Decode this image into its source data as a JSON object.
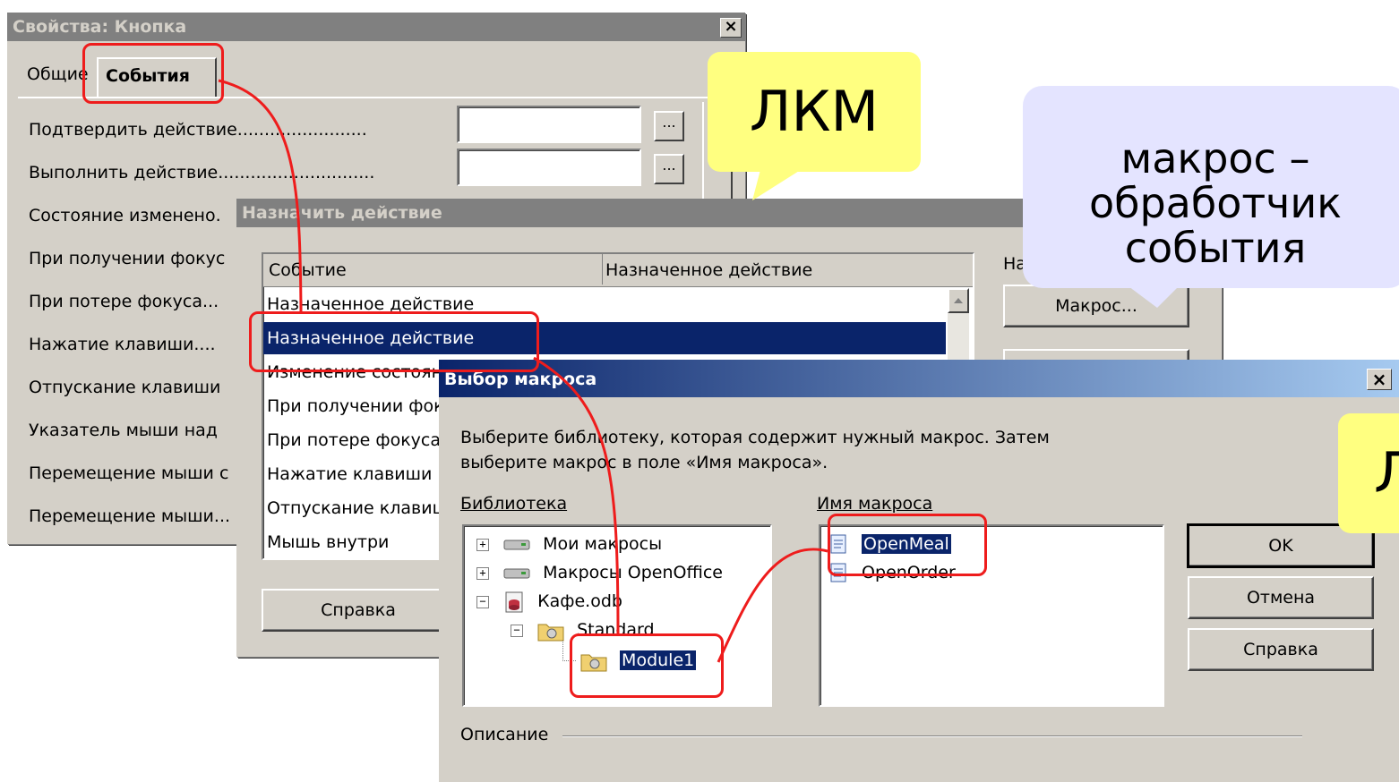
{
  "props_dialog": {
    "title": "Свойства: Кнопка",
    "close": "×",
    "tabs": [
      "Общие",
      "События"
    ],
    "events": [
      "Подтвердить действие........................",
      "Выполнить действие.............................",
      "Состояние изменено.",
      "При получении фокус",
      "При потере фокуса...",
      "Нажатие клавиши....",
      "Отпускание клавиши",
      "Указатель мыши над",
      "Перемещение мыши с",
      "Перемещение мыши..."
    ],
    "dots_button": "..."
  },
  "assign_dialog": {
    "title": "Назначить действие",
    "columns": [
      "Событие",
      "Назначенное действие"
    ],
    "rows": [
      "Назначенное действие",
      "Назначенное действие",
      "Изменение состояния",
      "При получении фокуса",
      "При потере фокуса",
      "Нажатие клавиши",
      "Отпускание клавиши",
      "Мышь внутри"
    ],
    "right_label": "На",
    "macro_button": "Макрос...",
    "help_button": "Справка"
  },
  "macro_dialog": {
    "title": "Выбор макроса",
    "close": "×",
    "instructions_1": "Выберите библиотеку, которая содержит нужный макрос. Затем",
    "instructions_2": "выберите макрос в поле «Имя макроса».",
    "library_label": "Библиотека",
    "macro_name_label": "Имя макроса",
    "tree": [
      {
        "label": "Мои макросы",
        "expander": "+"
      },
      {
        "label": "Макросы OpenOffice",
        "expander": "+"
      },
      {
        "label": "Кафе.odb",
        "expander": "−"
      },
      {
        "label": "Standard",
        "expander": "−"
      },
      {
        "label": "Module1",
        "expander": ""
      }
    ],
    "macros": [
      "OpenMeal",
      "OpenOrder"
    ],
    "ok_button": "OK",
    "cancel_button": "Отмена",
    "help_button": "Справка",
    "description_label": "Описание"
  },
  "callouts": {
    "lkm_1": "ЛКМ",
    "lkm_2": "Л",
    "macro_note_1": "макрос –",
    "macro_note_2": "обработчик",
    "macro_note_3": "события"
  },
  "colors": {
    "dialog_face": "#d4d0c8",
    "inactive_title": "#808080",
    "active_title_start": "#0a246a",
    "active_title_end": "#a6caf0",
    "selection": "#0a246a",
    "highlight_red": "#ee1c1c",
    "callout_yellow": "#ffff80",
    "callout_blue": "#e4e4ff"
  }
}
